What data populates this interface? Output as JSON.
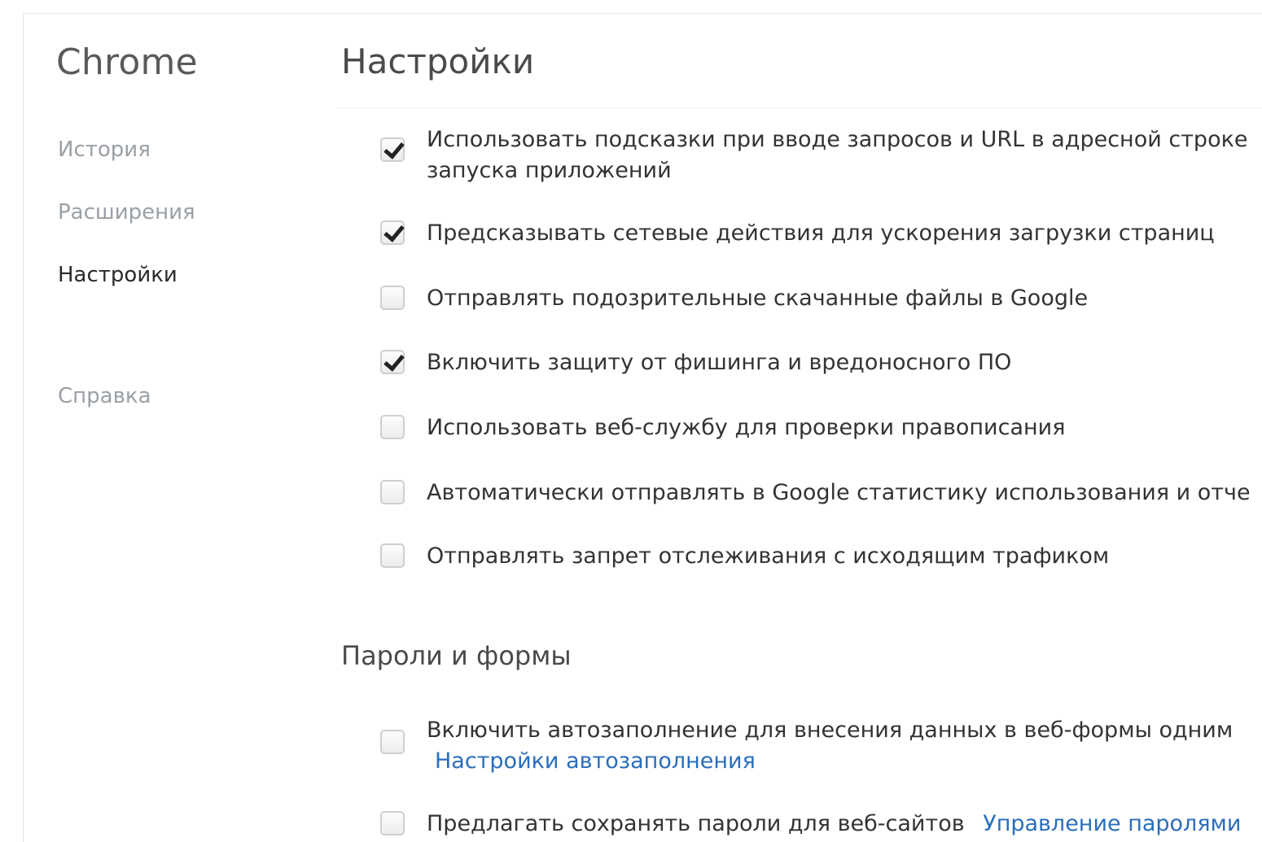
{
  "sidebar": {
    "app_title": "Chrome",
    "items": [
      {
        "label": "История",
        "active": false
      },
      {
        "label": "Расширения",
        "active": false
      },
      {
        "label": "Настройки",
        "active": true
      },
      {
        "label": "Справка",
        "active": false
      }
    ]
  },
  "main": {
    "title": "Настройки",
    "privacy_options": [
      {
        "label_line1": "Использовать подсказки при вводе запросов и URL в адресной строке",
        "label_line2": "запуска приложений",
        "checked": true
      },
      {
        "label": "Предсказывать сетевые действия для ускорения загрузки страниц",
        "checked": true
      },
      {
        "label": "Отправлять подозрительные скачанные файлы в Google",
        "checked": false
      },
      {
        "label": "Включить защиту от фишинга и вредоносного ПО",
        "checked": true
      },
      {
        "label": "Использовать веб-службу для проверки правописания",
        "checked": false
      },
      {
        "label": "Автоматически отправлять в Google статистику использования и отче",
        "checked": false
      },
      {
        "label": "Отправлять запрет отслеживания с исходящим трафиком",
        "checked": false
      }
    ],
    "passwords_section": {
      "title": "Пароли и формы",
      "options": [
        {
          "label": "Включить автозаполнение для внесения данных в веб-формы одним",
          "link": "Настройки автозаполнения",
          "checked": false
        },
        {
          "label": "Предлагать сохранять пароли для веб-сайтов",
          "link": "Управление паролями",
          "checked": false
        }
      ]
    }
  },
  "colors": {
    "link": "#2a6ebb",
    "muted_nav": "#9aa0a6",
    "text": "#333333"
  }
}
